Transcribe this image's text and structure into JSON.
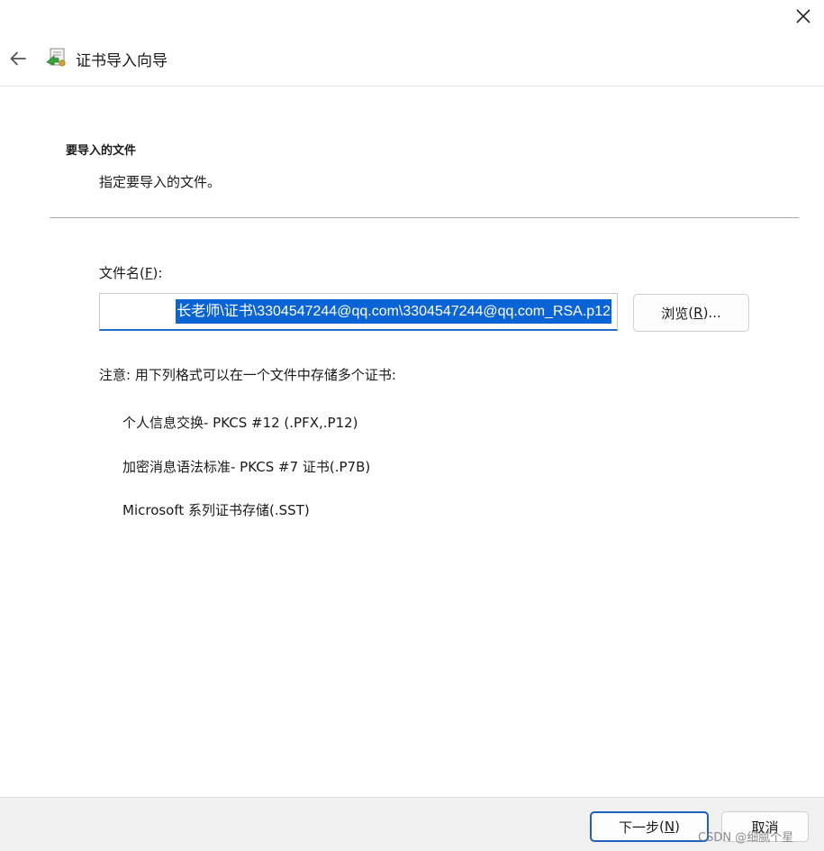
{
  "window": {
    "title": "证书导入向导",
    "close_label": "×"
  },
  "section": {
    "title": "要导入的文件",
    "subtitle": "指定要导入的文件。"
  },
  "file": {
    "label": "文件名",
    "label_key": "F",
    "label_suffix": ":",
    "value": "长老师\\证书\\3304547244@qq.com\\3304547244@qq.com_RSA.p12",
    "browse_label": "浏览",
    "browse_key": "R",
    "browse_suffix": "..."
  },
  "note": "注意: 用下列格式可以在一个文件中存储多个证书:",
  "formats": [
    "个人信息交换- PKCS #12 (.PFX,.P12)",
    "加密消息语法标准- PKCS #7 证书(.P7B)",
    "Microsoft 系列证书存储(.SST)"
  ],
  "footer": {
    "next_label": "下一步",
    "next_key": "N",
    "cancel_label": "取消"
  },
  "watermark": "CSDN @细腻个星",
  "icons": {
    "back": "back-arrow-icon",
    "close": "close-icon",
    "wizard": "certificate-wizard-icon"
  },
  "colors": {
    "accent": "#1f6cc9",
    "selection": "#0a64d6",
    "footer_bg": "#f0f0f0"
  }
}
